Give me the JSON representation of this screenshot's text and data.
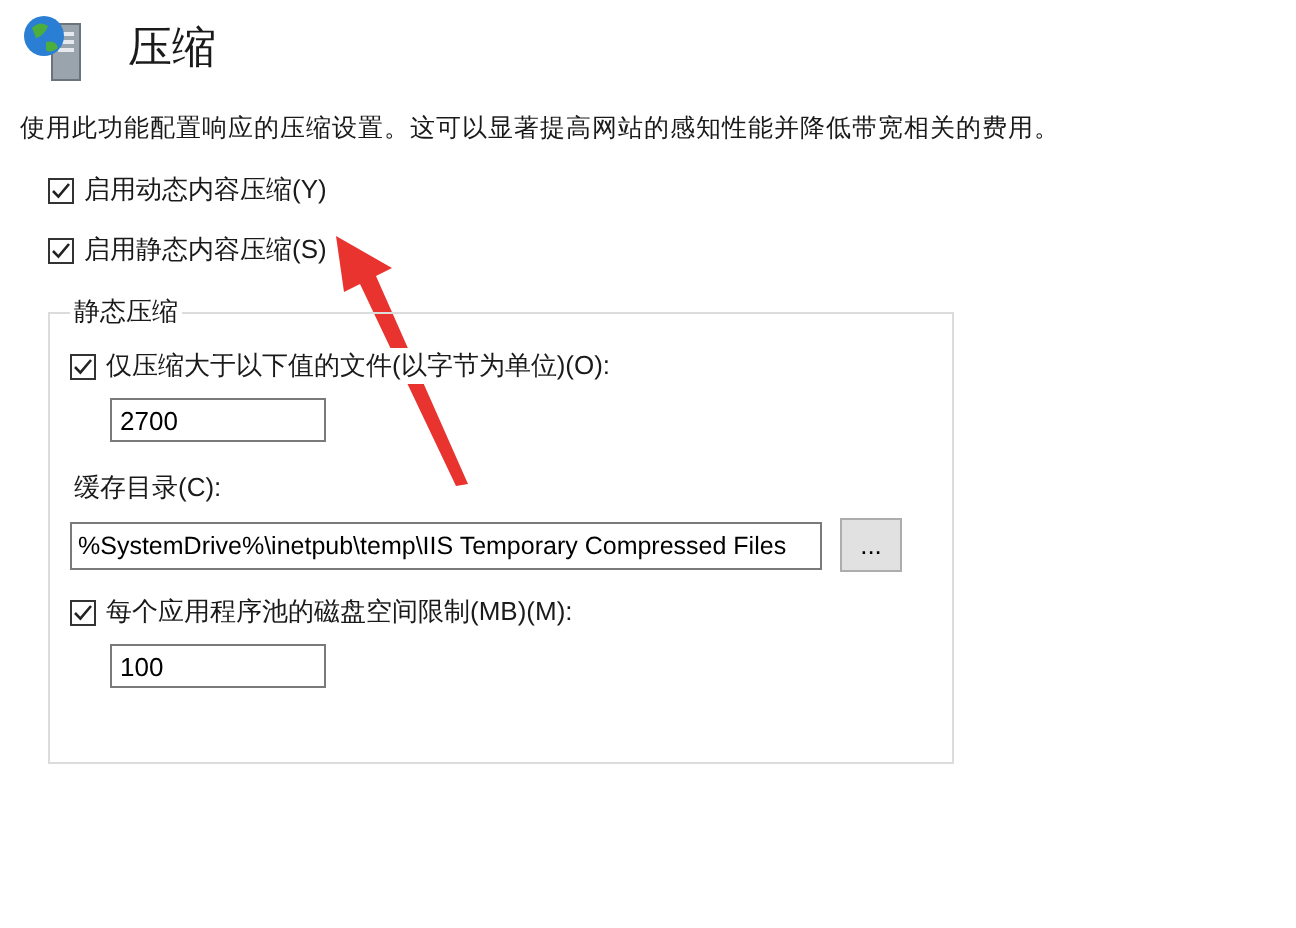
{
  "header": {
    "title": "压缩"
  },
  "description": "使用此功能配置响应的压缩设置。这可以显著提高网站的感知性能并降低带宽相关的费用。",
  "options": [
    {
      "label": "启用动态内容压缩(Y)",
      "checked": true
    },
    {
      "label": "启用静态内容压缩(S)",
      "checked": true
    }
  ],
  "static_group": {
    "legend": "静态压缩",
    "items": [
      {
        "kind": "checkbox",
        "label": "仅压缩大于以下值的文件(以字节为单位)(O):",
        "checked": true
      },
      {
        "kind": "field",
        "value": "2700"
      },
      {
        "kind": "label",
        "text": "缓存目录(C):"
      },
      {
        "kind": "path",
        "value": "%SystemDrive%\\inetpub\\temp\\IIS Temporary Compressed Files",
        "button": "..."
      },
      {
        "kind": "checkbox",
        "label": "每个应用程序池的磁盘空间限制(MB)(M):",
        "checked": true
      },
      {
        "kind": "field",
        "value": "100"
      }
    ]
  }
}
